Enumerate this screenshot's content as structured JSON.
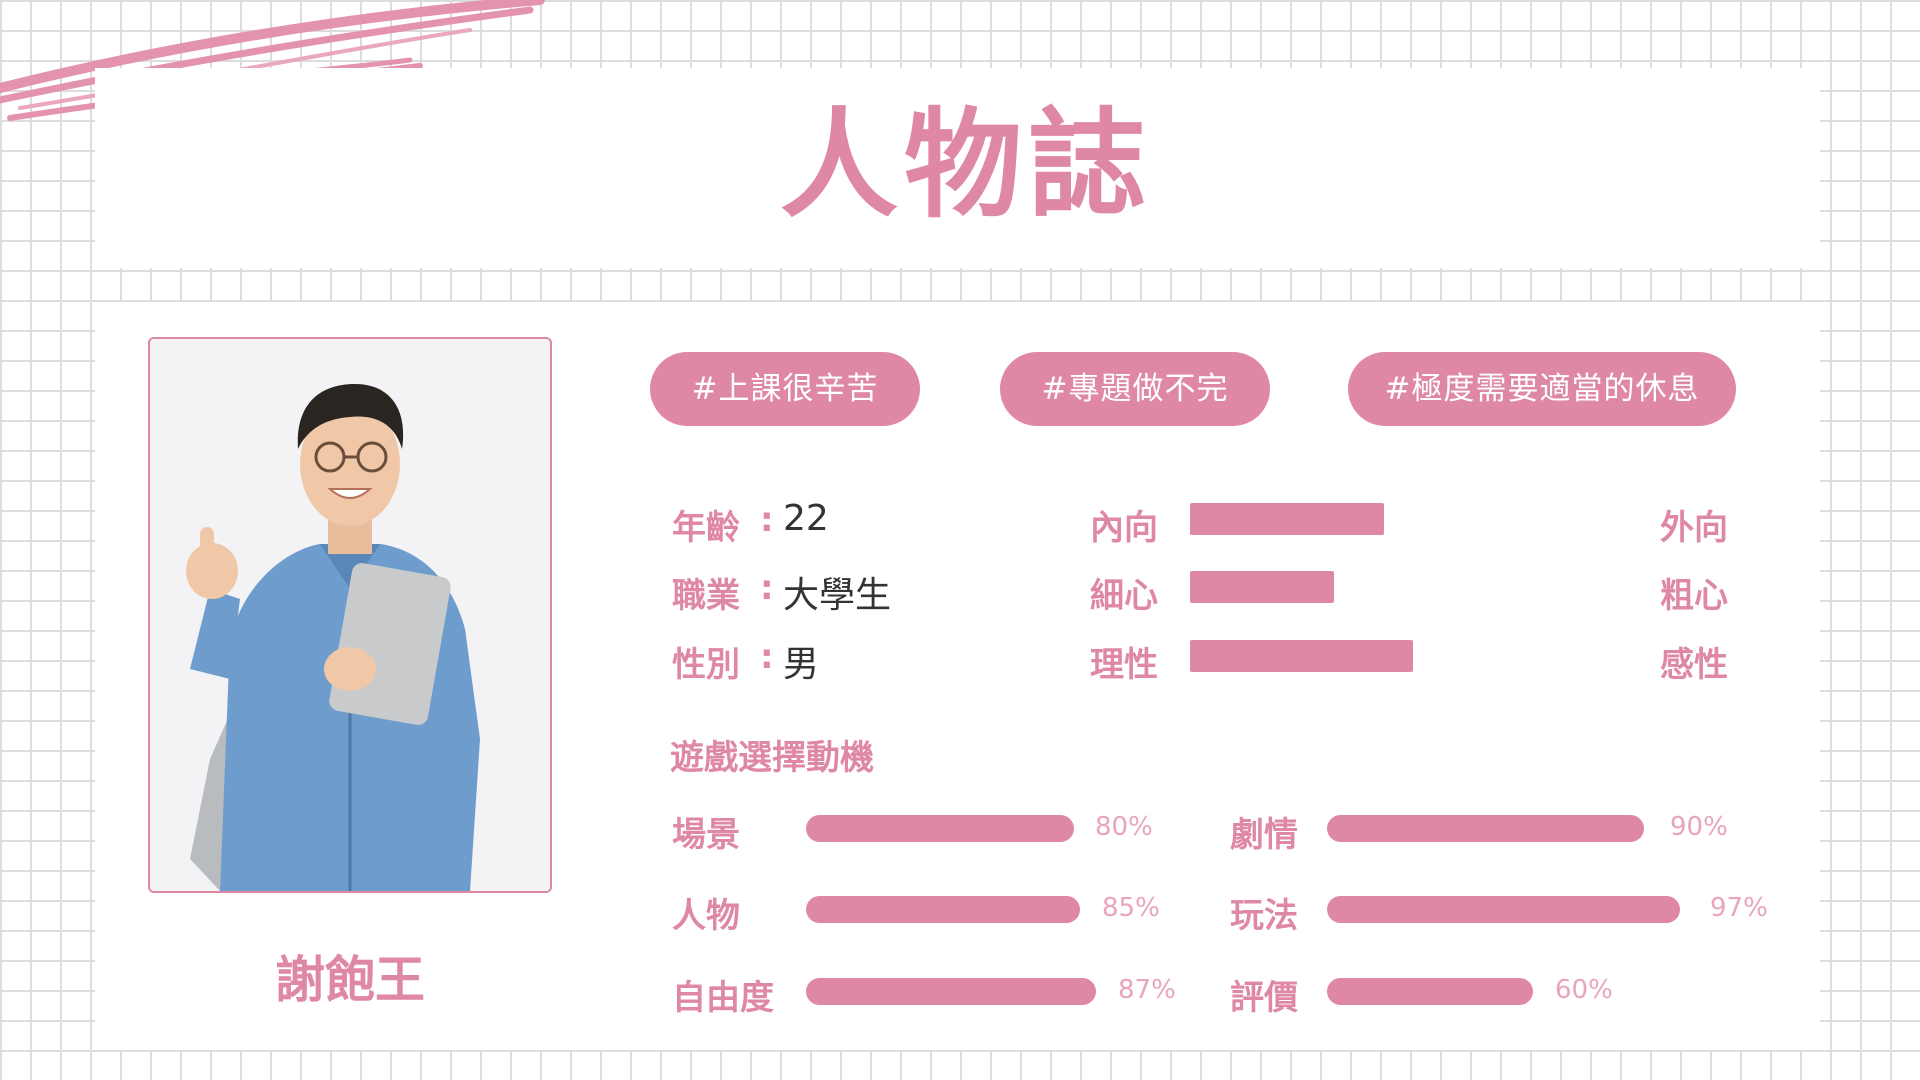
{
  "title": "人物誌",
  "person": {
    "name": "謝飽王",
    "photo_alt": "smiling young man with glasses holding a laptop and giving a thumbs up"
  },
  "tags": [
    "#上課很辛苦",
    "#專題做不完",
    "#極度需要適當的休息"
  ],
  "info": [
    {
      "label": "年齡",
      "colon": ":",
      "value": "22"
    },
    {
      "label": "職業",
      "colon": ":",
      "value": "大學生"
    },
    {
      "label": "性別",
      "colon": ":",
      "value": "男"
    }
  ],
  "traits": [
    {
      "left": "內向",
      "right": "外向",
      "level": 0.54
    },
    {
      "left": "細心",
      "right": "粗心",
      "level": 0.4
    },
    {
      "left": "理性",
      "right": "感性",
      "level": 0.62
    }
  ],
  "motivation": {
    "title": "遊戲選擇動機",
    "items": [
      {
        "label": "場景",
        "value": "80%",
        "level": 0.8
      },
      {
        "label": "劇情",
        "value": "90%",
        "level": 0.9
      },
      {
        "label": "人物",
        "value": "85%",
        "level": 0.85
      },
      {
        "label": "玩法",
        "value": "97%",
        "level": 0.97
      },
      {
        "label": "自由度",
        "value": "87%",
        "level": 0.87
      },
      {
        "label": "評價",
        "value": "60%",
        "level": 0.6
      }
    ]
  },
  "colors": {
    "accent": "#df88a5",
    "grid": "#dcdcdc",
    "text": "#333333"
  }
}
